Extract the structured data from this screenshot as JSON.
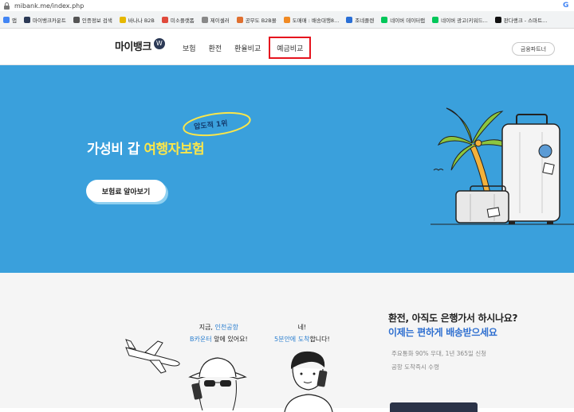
{
  "browser": {
    "url": "mibank.me/index.php",
    "bookmarks": [
      {
        "label": "앱",
        "color": "#4285f4"
      },
      {
        "label": "마이뱅크카운트",
        "color": "#2c3a56"
      },
      {
        "label": "인증정보 검색",
        "color": "#555555"
      },
      {
        "label": "바나나 B2B",
        "color": "#e6b800"
      },
      {
        "label": "미소플랫폼",
        "color": "#e04a3c"
      },
      {
        "label": "제이셀러",
        "color": "#888888"
      },
      {
        "label": "공무도 B2B몰",
        "color": "#e07030"
      },
      {
        "label": "도매매 : 배송대행8...",
        "color": "#f08a24"
      },
      {
        "label": "조네플렌",
        "color": "#2a6fd6"
      },
      {
        "label": "네이버 데이터랩",
        "color": "#03c75a"
      },
      {
        "label": "네이버 광고(키워드...",
        "color": "#03c75a"
      },
      {
        "label": "판다랭크 - 스마트...",
        "color": "#111111"
      }
    ]
  },
  "header": {
    "logo": "마이뱅크",
    "logo_badge": "W",
    "nav": [
      "보험",
      "환전",
      "환율비교",
      "예금비교"
    ],
    "partner_button": "금융파트너"
  },
  "hero": {
    "title_prefix": "가성비 갑 ",
    "title_highlight": "여행자보험",
    "badge": "압도적 1위",
    "cta": "보험료 알아보기"
  },
  "lower": {
    "speech1_line1": "지금,",
    "speech1_line1_hl": "인천공항",
    "speech1_line2_hl": "B카운터",
    "speech1_line2": "앞에 있어요!",
    "speech2_line1": "네!",
    "speech2_line2_hl": "5분안에 도착",
    "speech2_line2": "합니다!",
    "promo_title": "환전, 아직도 은행가서 하시나요?",
    "promo_sub": "이제는 편하게 배송받으세요",
    "promo_desc1": "주요통화 90% 우대, 1년 365일 신청",
    "promo_desc2": "공항 도착즉시 수령"
  },
  "colors": {
    "hero_bg": "#3aa0dc",
    "highlight": "#fbe64a",
    "active_outline": "#e5141e",
    "promo_blue": "#2e6fd0"
  }
}
